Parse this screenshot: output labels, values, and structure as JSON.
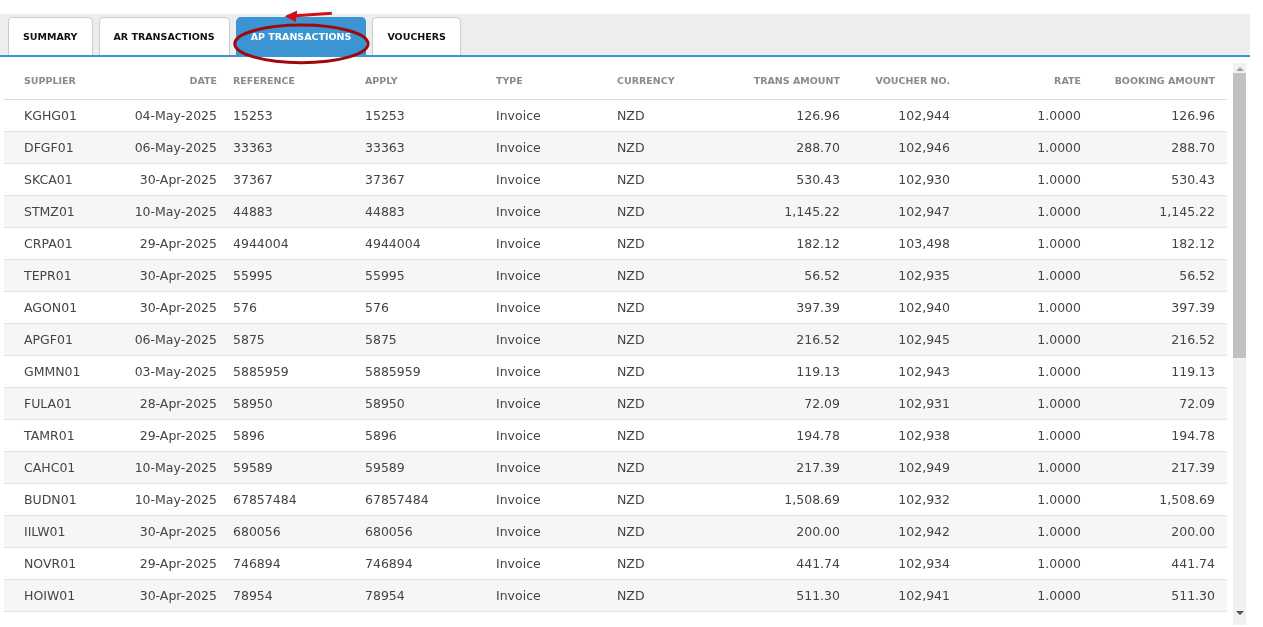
{
  "tabs": [
    {
      "label": "SUMMARY",
      "selected": false
    },
    {
      "label": "AR TRANSACTIONS",
      "selected": false
    },
    {
      "label": "AP TRANSACTIONS",
      "selected": true,
      "highlighted": true
    },
    {
      "label": "VOUCHERS",
      "selected": false
    }
  ],
  "table": {
    "columns": [
      "SUPPLIER",
      "DATE",
      "REFERENCE",
      "APPLY",
      "TYPE",
      "CURRENCY",
      "TRANS AMOUNT",
      "VOUCHER NO.",
      "RATE",
      "BOOKING AMOUNT"
    ],
    "rows": [
      [
        "KGHG01",
        "04-May-2025",
        "15253",
        "15253",
        "Invoice",
        "NZD",
        "126.96",
        "102,944",
        "1.0000",
        "126.96"
      ],
      [
        "DFGF01",
        "06-May-2025",
        "33363",
        "33363",
        "Invoice",
        "NZD",
        "288.70",
        "102,946",
        "1.0000",
        "288.70"
      ],
      [
        "SKCA01",
        "30-Apr-2025",
        "37367",
        "37367",
        "Invoice",
        "NZD",
        "530.43",
        "102,930",
        "1.0000",
        "530.43"
      ],
      [
        "STMZ01",
        "10-May-2025",
        "44883",
        "44883",
        "Invoice",
        "NZD",
        "1,145.22",
        "102,947",
        "1.0000",
        "1,145.22"
      ],
      [
        "CRPA01",
        "29-Apr-2025",
        "4944004",
        "4944004",
        "Invoice",
        "NZD",
        "182.12",
        "103,498",
        "1.0000",
        "182.12"
      ],
      [
        "TEPR01",
        "30-Apr-2025",
        "55995",
        "55995",
        "Invoice",
        "NZD",
        "56.52",
        "102,935",
        "1.0000",
        "56.52"
      ],
      [
        "AGON01",
        "30-Apr-2025",
        "576",
        "576",
        "Invoice",
        "NZD",
        "397.39",
        "102,940",
        "1.0000",
        "397.39"
      ],
      [
        "APGF01",
        "06-May-2025",
        "5875",
        "5875",
        "Invoice",
        "NZD",
        "216.52",
        "102,945",
        "1.0000",
        "216.52"
      ],
      [
        "GMMN01",
        "03-May-2025",
        "5885959",
        "5885959",
        "Invoice",
        "NZD",
        "119.13",
        "102,943",
        "1.0000",
        "119.13"
      ],
      [
        "FULA01",
        "28-Apr-2025",
        "58950",
        "58950",
        "Invoice",
        "NZD",
        "72.09",
        "102,931",
        "1.0000",
        "72.09"
      ],
      [
        "TAMR01",
        "29-Apr-2025",
        "5896",
        "5896",
        "Invoice",
        "NZD",
        "194.78",
        "102,938",
        "1.0000",
        "194.78"
      ],
      [
        "CAHC01",
        "10-May-2025",
        "59589",
        "59589",
        "Invoice",
        "NZD",
        "217.39",
        "102,949",
        "1.0000",
        "217.39"
      ],
      [
        "BUDN01",
        "10-May-2025",
        "67857484",
        "67857484",
        "Invoice",
        "NZD",
        "1,508.69",
        "102,932",
        "1.0000",
        "1,508.69"
      ],
      [
        "IILW01",
        "30-Apr-2025",
        "680056",
        "680056",
        "Invoice",
        "NZD",
        "200.00",
        "102,942",
        "1.0000",
        "200.00"
      ],
      [
        "NOVR01",
        "29-Apr-2025",
        "746894",
        "746894",
        "Invoice",
        "NZD",
        "441.74",
        "102,934",
        "1.0000",
        "441.74"
      ],
      [
        "HOIW01",
        "30-Apr-2025",
        "78954",
        "78954",
        "Invoice",
        "NZD",
        "511.30",
        "102,941",
        "1.0000",
        "511.30"
      ]
    ]
  }
}
